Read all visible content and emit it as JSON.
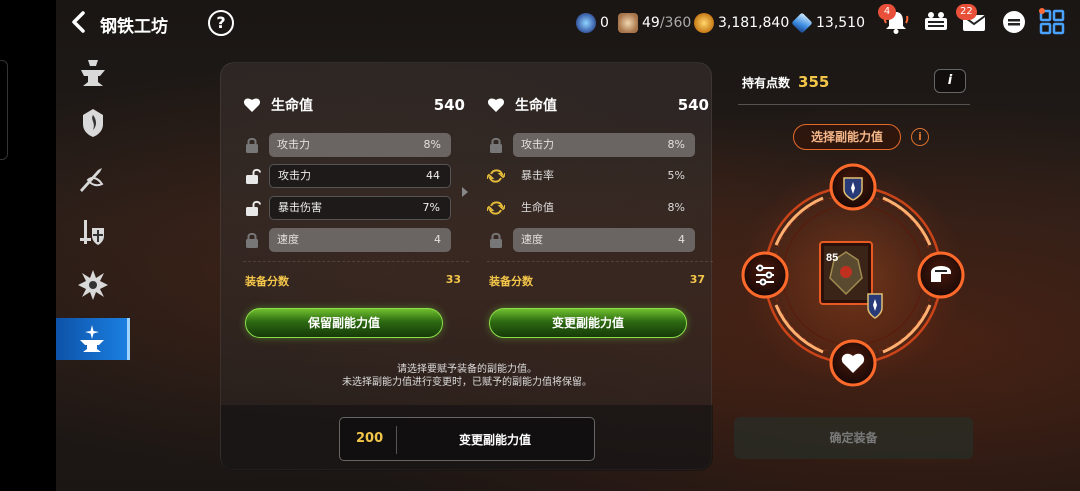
{
  "header": {
    "title": "钢铁工坊",
    "help_icon": "question-icon",
    "resources": {
      "gem_count": "0",
      "stamina_current": "49",
      "stamina_max": "/360",
      "gold": "3,181,840",
      "crystal": "13,510"
    },
    "notifications_badge": "4",
    "mail_badge": "22"
  },
  "sidebar": {
    "items": [
      {
        "icon": "anvil-icon"
      },
      {
        "icon": "flame-shield-icon"
      },
      {
        "icon": "swords-icon"
      },
      {
        "icon": "sword-shield-icon"
      },
      {
        "icon": "burst-icon"
      },
      {
        "icon": "sparkle-anvil-icon"
      }
    ]
  },
  "current": {
    "hp_label": "生命值",
    "hp_value": "540",
    "rows": [
      {
        "label": "攻击力",
        "value": "8%"
      },
      {
        "label": "攻击力",
        "value": "44"
      },
      {
        "label": "暴击伤害",
        "value": "7%"
      },
      {
        "label": "速度",
        "value": "4"
      }
    ],
    "score_label": "装备分数",
    "score_value": "33",
    "button": "保留副能力值"
  },
  "preview": {
    "hp_label": "生命值",
    "hp_value": "540",
    "rows": [
      {
        "label": "攻击力",
        "value": "8%"
      },
      {
        "label": "暴击率",
        "value": "5%"
      },
      {
        "label": "生命值",
        "value": "8%"
      },
      {
        "label": "速度",
        "value": "4"
      }
    ],
    "score_label": "装备分数",
    "score_value": "37",
    "button": "变更副能力值"
  },
  "note": {
    "line1": "请选择要赋予装备的副能力值。",
    "line2": "未选择副能力值进行变更时，已赋予的副能力值将保留。"
  },
  "change": {
    "cost": "200",
    "label": "变更副能力值"
  },
  "right": {
    "points_label": "持有点数",
    "points_value": "355",
    "info": "i",
    "choose_label": "选择副能力值",
    "item_level": "85",
    "confirm": "确定装备"
  },
  "colors": {
    "accent_gold": "#f3c64a",
    "accent_orange": "#e46a2a",
    "button_green": "#2d6a12",
    "sidebar_active": "#1b7fe0"
  }
}
